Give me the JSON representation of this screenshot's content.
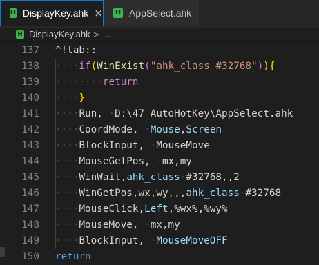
{
  "tabs": [
    {
      "icon": "H",
      "label": "DisplayKey.ahk",
      "active": true,
      "close": "×"
    },
    {
      "icon": "H",
      "label": "AppSelect.ahk",
      "active": false
    }
  ],
  "breadcrumb": {
    "icon": "H",
    "file": "DisplayKey.ahk",
    "separator": ">",
    "more": "..."
  },
  "editor": {
    "lines": [
      {
        "n": "137",
        "segs": [
          [
            "ws",
            ""
          ],
          [
            "plain",
            "^!tab::"
          ]
        ]
      },
      {
        "n": "138",
        "segs": [
          [
            "ws",
            "····"
          ],
          [
            "ctl",
            "if"
          ],
          [
            "br1",
            "("
          ],
          [
            "fn",
            "WinExist"
          ],
          [
            "br2",
            "("
          ],
          [
            "str",
            "\"ahk_class #32768\""
          ],
          [
            "br2",
            ")"
          ],
          [
            "br1",
            ")"
          ],
          [
            "br1",
            "{"
          ]
        ]
      },
      {
        "n": "139",
        "segs": [
          [
            "ws",
            "········"
          ],
          [
            "ctl",
            "return"
          ]
        ]
      },
      {
        "n": "140",
        "segs": [
          [
            "ws",
            "····"
          ],
          [
            "br1",
            "}"
          ]
        ]
      },
      {
        "n": "141",
        "segs": [
          [
            "ws",
            "····"
          ],
          [
            "plain",
            "Run, "
          ],
          [
            "ws",
            "·"
          ],
          [
            "plain",
            "D:\\47_AutoHotKey\\AppSelect.ahk"
          ]
        ]
      },
      {
        "n": "142",
        "segs": [
          [
            "ws",
            "····"
          ],
          [
            "plain",
            "CoordMode, "
          ],
          [
            "ws",
            "·"
          ],
          [
            "var",
            "Mouse"
          ],
          [
            "plain",
            ","
          ],
          [
            "var",
            "Screen"
          ]
        ]
      },
      {
        "n": "143",
        "segs": [
          [
            "ws",
            "····"
          ],
          [
            "plain",
            "BlockInput, "
          ],
          [
            "ws",
            "·"
          ],
          [
            "plain",
            "MouseMove"
          ]
        ]
      },
      {
        "n": "144",
        "segs": [
          [
            "ws",
            "····"
          ],
          [
            "plain",
            "MouseGetPos, "
          ],
          [
            "ws",
            "·"
          ],
          [
            "plain",
            "mx,my"
          ]
        ]
      },
      {
        "n": "145",
        "segs": [
          [
            "ws",
            "····"
          ],
          [
            "plain",
            "WinWait,"
          ],
          [
            "var",
            "ahk_class"
          ],
          [
            "ws",
            "·"
          ],
          [
            "plain",
            "#32768,,2"
          ]
        ]
      },
      {
        "n": "146",
        "segs": [
          [
            "ws",
            "····"
          ],
          [
            "plain",
            "WinGetPos,wx,wy,,,"
          ],
          [
            "var",
            "ahk_class"
          ],
          [
            "ws",
            "·"
          ],
          [
            "plain",
            "#32768"
          ]
        ]
      },
      {
        "n": "147",
        "segs": [
          [
            "ws",
            "····"
          ],
          [
            "plain",
            "MouseClick,"
          ],
          [
            "var",
            "Left"
          ],
          [
            "plain",
            ",%wx%,%wy%"
          ]
        ]
      },
      {
        "n": "148",
        "segs": [
          [
            "ws",
            "····"
          ],
          [
            "plain",
            "MouseMove, "
          ],
          [
            "ws",
            "·"
          ],
          [
            "plain",
            "mx,my"
          ]
        ]
      },
      {
        "n": "149",
        "segs": [
          [
            "ws",
            "····"
          ],
          [
            "plain",
            "BlockInput, "
          ],
          [
            "ws",
            "·"
          ],
          [
            "var",
            "MouseMoveOFF"
          ]
        ]
      },
      {
        "n": "150",
        "segs": [
          [
            "blu",
            "return"
          ]
        ]
      }
    ]
  }
}
